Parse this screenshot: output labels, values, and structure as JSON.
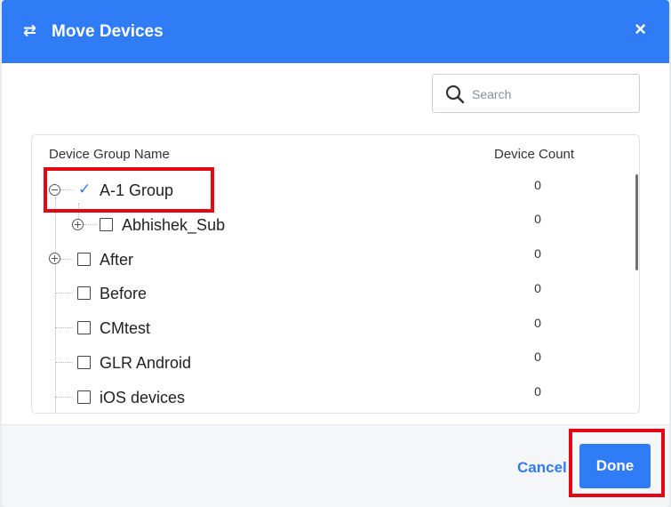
{
  "dialog": {
    "title": "Move Devices",
    "header_icon": "transfer-arrows-icon",
    "close_label": "×"
  },
  "search": {
    "placeholder": "Search",
    "value": ""
  },
  "table": {
    "columns": {
      "name": "Device Group Name",
      "count": "Device Count"
    },
    "rows": [
      {
        "name": "A-1 Group",
        "count": "0",
        "checked": true,
        "expander": "collapse",
        "level": 0
      },
      {
        "name": "Abhishek_Sub",
        "count": "0",
        "checked": false,
        "expander": "expand",
        "level": 1
      },
      {
        "name": "After",
        "count": "0",
        "checked": false,
        "expander": "expand",
        "level": 0
      },
      {
        "name": "Before",
        "count": "0",
        "checked": false,
        "expander": "none",
        "level": 0
      },
      {
        "name": "CMtest",
        "count": "0",
        "checked": false,
        "expander": "none",
        "level": 0
      },
      {
        "name": "GLR Android",
        "count": "0",
        "checked": false,
        "expander": "none",
        "level": 0
      },
      {
        "name": "iOS devices",
        "count": "0",
        "checked": false,
        "expander": "none",
        "level": 0
      }
    ]
  },
  "footer": {
    "cancel_label": "Cancel",
    "done_label": "Done"
  },
  "colors": {
    "accent": "#2f7cf6",
    "highlight": "#e30613"
  }
}
